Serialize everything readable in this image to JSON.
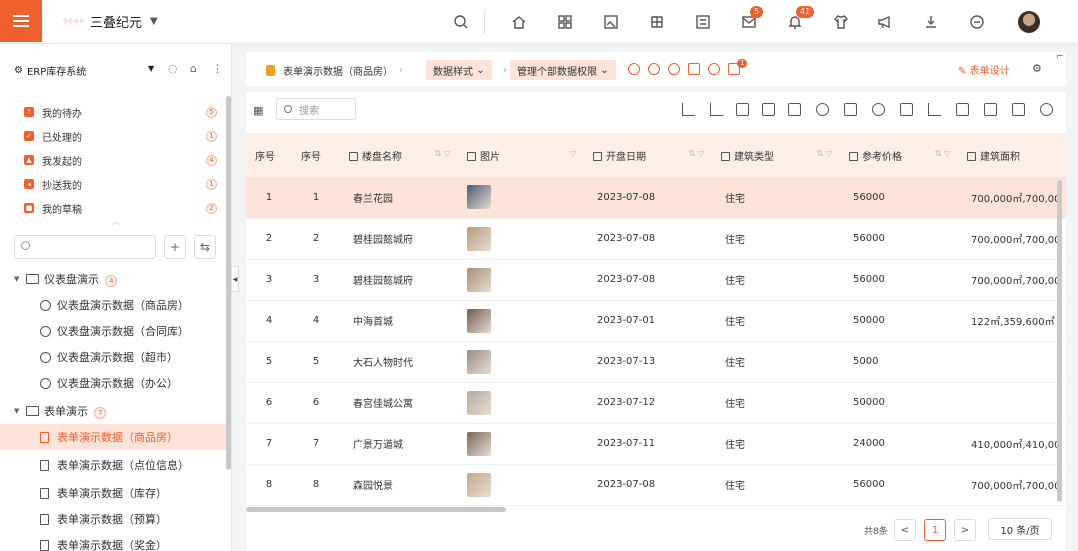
{
  "header": {
    "app_name": "三叠纪元",
    "message_badge": "5",
    "notice_badge": "41"
  },
  "sidebar": {
    "system_name": "ERP库存系统",
    "todos": [
      {
        "label": "我的待办",
        "count": "5"
      },
      {
        "label": "已处理的",
        "count": "1"
      },
      {
        "label": "我发起的",
        "count": "4"
      },
      {
        "label": "抄送我的",
        "count": "1"
      },
      {
        "label": "我的草稿",
        "count": "2"
      }
    ],
    "search_placeholder": "",
    "tree": [
      {
        "label": "仪表盘演示",
        "count": "4",
        "children": [
          "仪表盘演示数据（商品房）",
          "仪表盘演示数据（合同库）",
          "仪表盘演示数据（超市）",
          "仪表盘演示数据（办公）"
        ]
      },
      {
        "label": "表单演示",
        "count": "7",
        "children": [
          "表单演示数据（商品房）",
          "表单演示数据（点位信息）",
          "表单演示数据（库存）",
          "表单演示数据（预算）",
          "表单演示数据（奖金）"
        ]
      }
    ]
  },
  "breadcrumb": {
    "page": "表单演示数据（商品房）",
    "view": "数据样式",
    "permission": "管理个部数据权限",
    "alert_badge": "1",
    "design_label": "表单设计"
  },
  "toolbar": {
    "search_placeholder": "搜索"
  },
  "table": {
    "headers": [
      "序号",
      "序号",
      "楼盘名称",
      "图片",
      "开盘日期",
      "建筑类型",
      "参考价格",
      "建筑面积"
    ],
    "rows": [
      [
        "1",
        "1",
        "春兰花园",
        "2023-07-08",
        "住宅",
        "56000",
        "700,000㎡,700,00"
      ],
      [
        "2",
        "2",
        "碧桂园懿城府",
        "2023-07-08",
        "住宅",
        "56000",
        "700,000㎡,700,00"
      ],
      [
        "3",
        "3",
        "碧桂园懿城府",
        "2023-07-08",
        "住宅",
        "56000",
        "700,000㎡,700,00"
      ],
      [
        "4",
        "4",
        "中海首城",
        "2023-07-01",
        "住宅",
        "50000",
        "122㎡,359,600㎡"
      ],
      [
        "5",
        "5",
        "大石人物时代",
        "2023-07-13",
        "住宅",
        "5000",
        ""
      ],
      [
        "6",
        "6",
        "春宫佳城公寓",
        "2023-07-12",
        "住宅",
        "50000",
        ""
      ],
      [
        "7",
        "7",
        "广景万道城",
        "2023-07-11",
        "住宅",
        "24000",
        "410,000㎡,410,00"
      ],
      [
        "8",
        "8",
        "森园悦景",
        "2023-07-08",
        "住宅",
        "56000",
        "700,000㎡,700,00"
      ]
    ]
  },
  "pagination": {
    "total": "共8条",
    "prev": "<",
    "current": "1",
    "next": ">",
    "page_size": "10 条/页"
  }
}
